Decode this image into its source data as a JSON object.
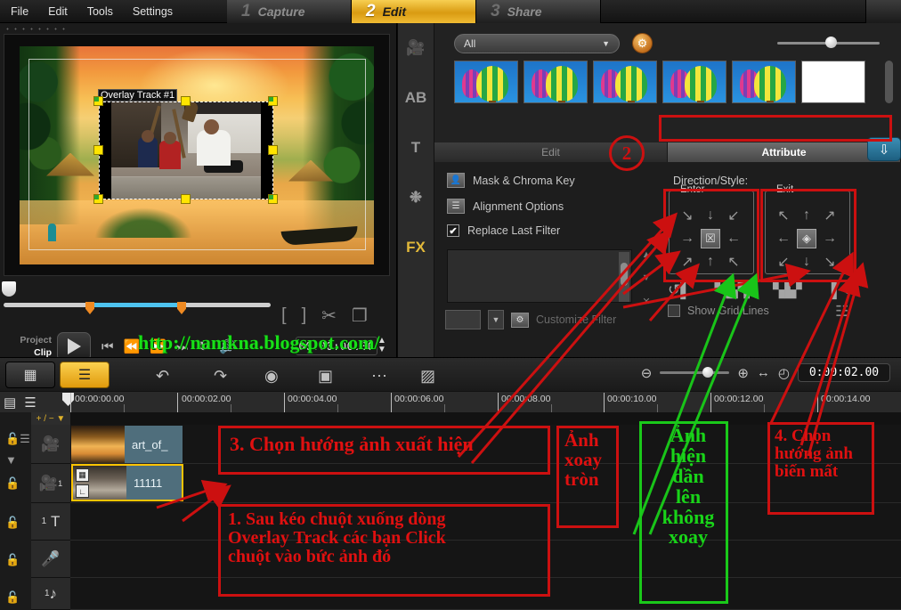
{
  "menu": {
    "items": [
      {
        "label": "File"
      },
      {
        "label": "Edit"
      },
      {
        "label": "Tools"
      },
      {
        "label": "Settings"
      }
    ],
    "steps": [
      {
        "num": "1",
        "label": "Capture",
        "active": false
      },
      {
        "num": "2",
        "label": "Edit",
        "active": true
      },
      {
        "num": "3",
        "label": "Share",
        "active": false
      }
    ]
  },
  "preview": {
    "overlay_label": "Overlay Track #1",
    "timecode": "00:00:00.00",
    "project_label": "Project",
    "clip_label": "Clip",
    "tools": [
      "mark-in-bracket",
      "mark-out-bracket",
      "cut-scissors",
      "copy-clip"
    ],
    "transport": [
      "skip-to-start",
      "previous-frame",
      "next-frame",
      "skip-to-end",
      "loop",
      "volume"
    ]
  },
  "watermark": "http://namkna.blogspot.com/",
  "library": {
    "filter_value": "All",
    "tab_edit": "Edit",
    "tab_attribute": "Attribute",
    "thumbnails": [
      "balloon-1",
      "balloon-2",
      "balloon-3",
      "balloon-4",
      "balloon-5",
      "blank-white"
    ]
  },
  "options": {
    "mask_chroma": "Mask & Chroma Key",
    "alignment": "Alignment Options",
    "replace_last_filter": "Replace Last Filter",
    "replace_checked": "✔",
    "customize_filter": "Customize Filter",
    "direction_style_title": "Direction/Style:",
    "enter_legend": "Enter",
    "exit_legend": "Exit",
    "show_grid_lines": "Show Grid Lines",
    "enter_arrows": [
      "↘",
      "↓",
      "↙",
      "→",
      "☒",
      "←",
      "↗",
      "↑",
      "↖"
    ],
    "exit_arrows": [
      "↖",
      "↑",
      "↗",
      "←",
      "◈",
      "→",
      "↙",
      "↓",
      "↘"
    ],
    "fx_icons": [
      "rotate-in-icon",
      "fade-in-bars-icon",
      "fade-out-bars-icon",
      "rotate-out-icon"
    ]
  },
  "timeline": {
    "buttons": [
      {
        "name": "storyboard-view",
        "glyph": "▤",
        "active": false
      },
      {
        "name": "timeline-view",
        "glyph": "☰",
        "active": true
      }
    ],
    "tools": [
      {
        "name": "undo-icon",
        "glyph": "↶"
      },
      {
        "name": "redo-icon",
        "glyph": "↷"
      },
      {
        "name": "record-capture-icon",
        "glyph": "◉"
      },
      {
        "name": "media-overlay-icon",
        "glyph": "▣"
      },
      {
        "name": "audio-mixer-icon",
        "glyph": "⌇"
      },
      {
        "name": "sound-fx-icon",
        "glyph": "▨"
      }
    ],
    "zoom_out": "⊖",
    "zoom_in": "⊕",
    "fit_project": "↔",
    "clock": "◴",
    "timecode": "0:00:02.00",
    "ruler_ticks": [
      "00:00:00.00",
      "00:00:02.00",
      "00:00:04.00",
      "00:00:06.00",
      "00:00:08.00",
      "00:00:10.00",
      "00:00:12.00",
      "00:00:14.00"
    ],
    "add_remove": "+ / − ▼",
    "tracks": [
      {
        "name": "video-track",
        "icon": "◎",
        "label": ""
      },
      {
        "name": "overlay-track-1",
        "icon": "◎",
        "label": "1"
      },
      {
        "name": "title-track-1",
        "icon": "T",
        "label": "1"
      },
      {
        "name": "voice-track",
        "icon": "●",
        "label": ""
      },
      {
        "name": "music-track-1",
        "icon": "♫",
        "label": "1"
      }
    ],
    "clips": [
      {
        "track": 0,
        "label": "art_of_",
        "selected": false
      },
      {
        "track": 1,
        "label": "11111",
        "selected": true
      }
    ]
  },
  "annotations": [
    {
      "id": "circle-2",
      "text": "2",
      "color": "#cc1010"
    },
    {
      "id": "note-3",
      "text": "3. Chọn hướng ảnh xuất hiện",
      "color": "#e01010"
    },
    {
      "id": "note-1",
      "lines": [
        "1. Sau kéo chuột xuống dòng",
        "Overlay Track  các bạn Click",
        "chuột vào bức ảnh đó"
      ],
      "color": "#e01010"
    },
    {
      "id": "note-rotate",
      "lines": [
        "Ảnh",
        "xoay",
        "tròn"
      ],
      "color": "#e01010"
    },
    {
      "id": "note-fade",
      "lines": [
        "Ảnh",
        "hiện",
        "dần",
        "lên",
        "không",
        "xoay"
      ],
      "color": "#19d419"
    },
    {
      "id": "note-4",
      "lines": [
        "4. Chọn",
        "hướng ảnh",
        "biến mất"
      ],
      "color": "#e01010"
    }
  ]
}
